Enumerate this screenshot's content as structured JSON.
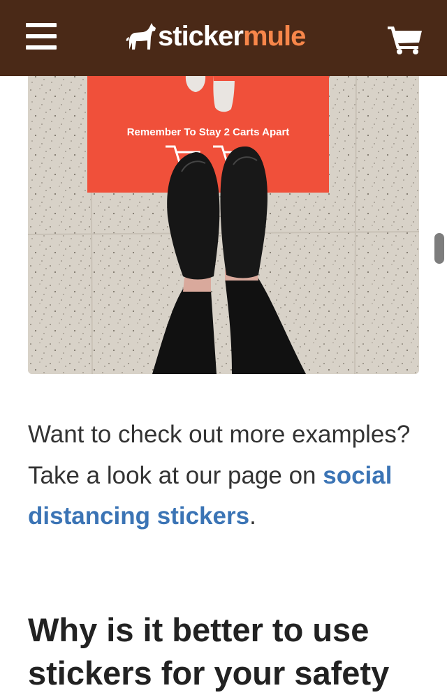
{
  "header": {
    "logo": {
      "word1": "sticker",
      "word2": "mule"
    },
    "menu_icon": "hamburger-menu-icon",
    "cart_icon": "shopping-cart-icon",
    "colors": {
      "background": "#4a2917",
      "logo_accent": "#f7864a",
      "icon": "#ffffff"
    }
  },
  "photo": {
    "sticker_text": "Remember To Stay 2 Carts Apart",
    "sticker_color": "#f0503a"
  },
  "article": {
    "paragraph": {
      "text_before": "Want to check out more examples? Take a look at our page on ",
      "link_text": "social distancing stickers",
      "text_after": "."
    },
    "heading": "Why is it better to use stickers for your safety"
  },
  "colors": {
    "link": "#3b74b5",
    "body_text": "#333333"
  }
}
